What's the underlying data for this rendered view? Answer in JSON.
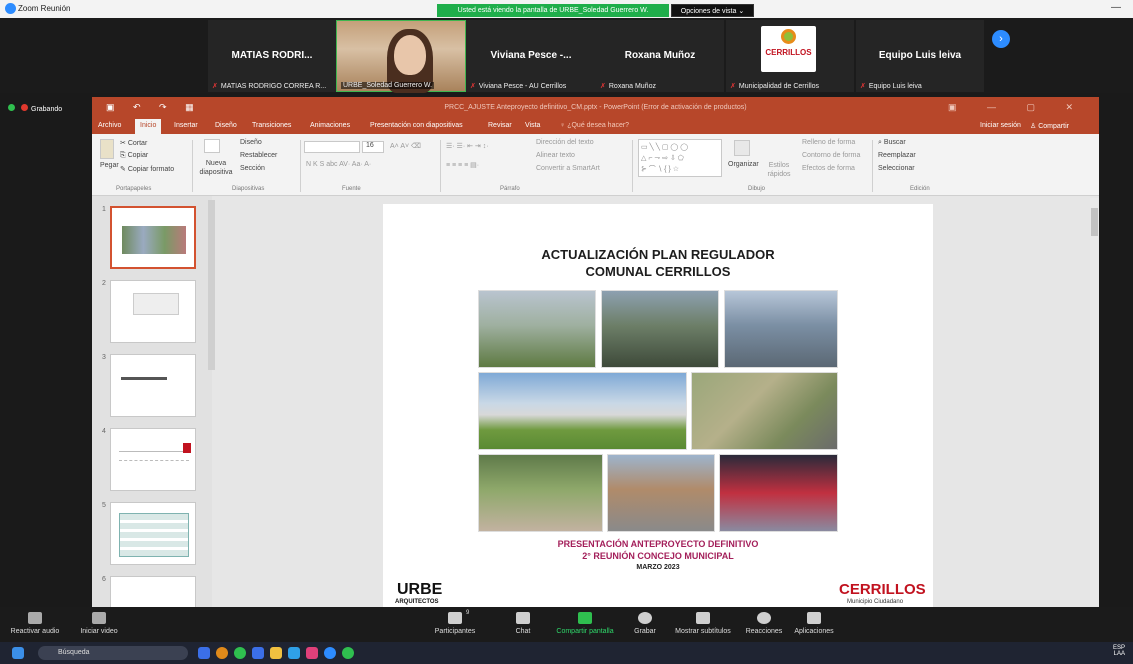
{
  "zoom": {
    "window_title": "Zoom Reunión",
    "share_banner": "Usted está viendo la pantalla de URBE_Soledad Guerrero W.",
    "view_options": "Opciones de vista",
    "view_options_arrow": "⌄",
    "minimize": "—",
    "recording_label": "Grabando",
    "participants": [
      {
        "display": "MATIAS RODRI...",
        "label": "MATIAS RODRIGO CORREA R..."
      },
      {
        "display": "",
        "label": "URBE_Soledad Guerrero W."
      },
      {
        "display": "Viviana Pesce -...",
        "label": "Viviana Pesce - AU Cerrillos"
      },
      {
        "display": "Roxana Muñoz",
        "label": "Roxana Muñoz"
      },
      {
        "display": "",
        "label": "Municipalidad de Cerrillos"
      },
      {
        "display": "Equipo Luis leiva",
        "label": "Equipo Luis leiva"
      }
    ],
    "cerrillos_logo": "CERRILLOS",
    "controls": [
      {
        "label": "Reactivar audio"
      },
      {
        "label": "Iniciar video"
      },
      {
        "label": "Participantes",
        "count": "9"
      },
      {
        "label": "Chat"
      },
      {
        "label": "Compartir pantalla"
      },
      {
        "label": "Grabar"
      },
      {
        "label": "Mostrar subtítulos"
      },
      {
        "label": "Reacciones"
      },
      {
        "label": "Aplicaciones"
      }
    ]
  },
  "ppt": {
    "title": "PRCC_AJUSTE Anteproyecto definitivo_CM.pptx - PowerPoint (Error de activación de productos)",
    "tabs": [
      "Archivo",
      "Inicio",
      "Insertar",
      "Diseño",
      "Transiciones",
      "Animaciones",
      "Presentación con diapositivas",
      "Revisar",
      "Vista"
    ],
    "tell_me": "¿Qué desea hacer?",
    "signin": "Iniciar sesión",
    "share": "Compartir",
    "ribbon": {
      "cut": "Cortar",
      "copy": "Copiar",
      "paste": "Pegar",
      "format_painter": "Copiar formato",
      "clipboard": "Portapapeles",
      "design": "Diseño",
      "reset": "Restablecer",
      "new_slide": "Nueva diapositiva",
      "section": "Sección",
      "slides": "Diapositivas",
      "font_size": "16",
      "font_group": "Fuente",
      "text_dir": "Dirección del texto",
      "align_text": "Alinear texto",
      "smartart": "Convertir a SmartArt",
      "paragraph": "Párrafo",
      "organize": "Organizar",
      "quick_styles": "Estilos rápidos",
      "drawing": "Dibujo",
      "fill": "Relleno de forma",
      "outline": "Contorno de forma",
      "effects": "Efectos de forma",
      "find": "Buscar",
      "replace": "Reemplazar",
      "select": "Seleccionar",
      "editing": "Edición"
    },
    "thumb_numbers": [
      "1",
      "2",
      "3",
      "4",
      "5",
      "6"
    ],
    "slide": {
      "title1": "ACTUALIZACIÓN PLAN REGULADOR",
      "title2": "COMUNAL CERRILLOS",
      "sub1": "PRESENTACIÓN ANTEPROYECTO DEFINITIVO",
      "sub2": "2° REUNIÓN CONCEJO MUNICIPAL",
      "date": "MARZO 2023",
      "urbe": "URBE",
      "urbe_sub": "ARQUITECTOS",
      "cerrillos": "CERRILLOS",
      "cerrillos_sub": "Municipio Ciudadano"
    }
  },
  "taskbar": {
    "search": "Búsqueda",
    "lang": "ESP",
    "lang2": "LAA"
  }
}
